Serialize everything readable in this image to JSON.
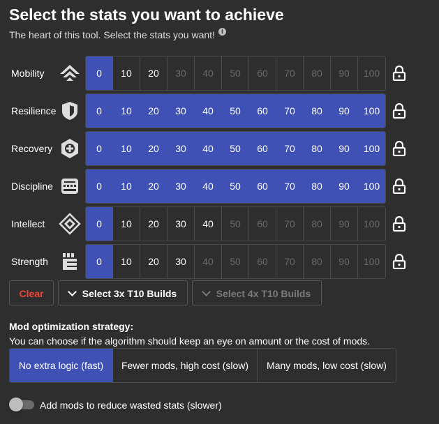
{
  "header": {
    "title": "Select the stats you want to achieve",
    "subtitle": "The heart of this tool. Select the stats you want!",
    "info_icon": "i"
  },
  "stats": [
    {
      "name": "Mobility",
      "icon": "mobility-icon",
      "selected_value": 0,
      "available_max": 20
    },
    {
      "name": "Resilience",
      "icon": "resilience-icon",
      "selected_value": 100,
      "available_max": 100
    },
    {
      "name": "Recovery",
      "icon": "recovery-icon",
      "selected_value": 100,
      "available_max": 100
    },
    {
      "name": "Discipline",
      "icon": "discipline-icon",
      "selected_value": 100,
      "available_max": 100
    },
    {
      "name": "Intellect",
      "icon": "intellect-icon",
      "selected_value": 0,
      "available_max": 40
    },
    {
      "name": "Strength",
      "icon": "strength-icon",
      "selected_value": 0,
      "available_max": 30
    }
  ],
  "stat_values": [
    "0",
    "10",
    "20",
    "30",
    "40",
    "50",
    "60",
    "70",
    "80",
    "90",
    "100"
  ],
  "buttons": {
    "clear": "Clear",
    "select_3x": "Select 3x T10 Builds",
    "select_4x": "Select 4x T10 Builds"
  },
  "strategy": {
    "title": "Mod optimization strategy:",
    "description": "You can choose if the algorithm should keep an eye on amount or the cost of mods.",
    "options": [
      "No extra logic (fast)",
      "Fewer mods, high cost (slow)",
      "Many mods, low cost (slow)"
    ],
    "selected_index": 0
  },
  "toggle": {
    "label": "Add mods to reduce wasted stats (slower)",
    "checked": false
  },
  "colors": {
    "accent": "#3f51b5",
    "danger": "#f44336",
    "background": "#2e2e2e",
    "border": "#4a4a4a",
    "disabled_text": "#6a6a6a"
  }
}
